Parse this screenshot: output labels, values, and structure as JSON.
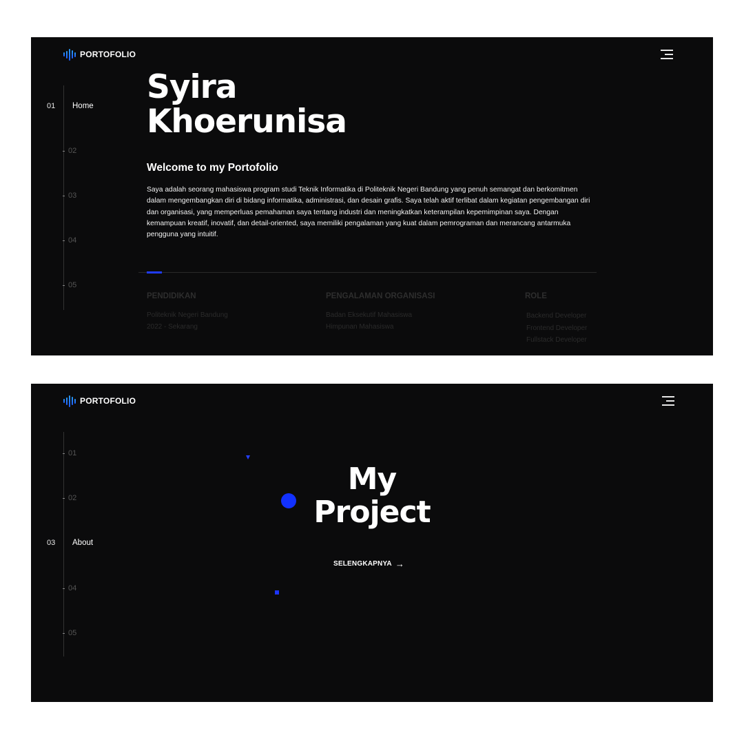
{
  "brand": {
    "logo_text": "PORTOFOLIO",
    "accent_color": "#1f3bff"
  },
  "screen1": {
    "sidebar": [
      {
        "num": "01",
        "label": "Home",
        "active": true
      },
      {
        "num": "02"
      },
      {
        "num": "03"
      },
      {
        "num": "04"
      },
      {
        "num": "05"
      }
    ],
    "hero": {
      "name_line1": "Syira",
      "name_line2": "Khoerunisa"
    },
    "welcome_title": "Welcome to my Portofolio",
    "intro": "Saya adalah seorang mahasiswa program studi Teknik Informatika di Politeknik Negeri Bandung yang penuh semangat dan berkomitmen dalam mengembangkan diri di bidang informatika, administrasi, dan desain grafis. Saya telah aktif terlibat dalam kegiatan pengembangan diri dan organisasi, yang memperluas pemahaman saya tentang industri dan meningkatkan keterampilan kepemimpinan saya. Dengan kemampuan kreatif, inovatif, dan detail-oriented, saya memiliki pengalaman yang kuat dalam pemrograman dan merancang antarmuka pengguna yang intuitif.",
    "info": {
      "pendidikan": {
        "title": "PENDIDIKAN",
        "lines": [
          "Politeknik Negeri Bandung",
          "2022 - Sekarang"
        ]
      },
      "organisasi": {
        "title": "PENGALAMAN ORGANISASI",
        "lines": [
          "Badan Eksekutif Mahasiswa",
          "Himpunan Mahasiswa"
        ]
      },
      "role": {
        "title": "ROLE",
        "lines": [
          "Backend Developer",
          "Frontend Developer",
          "Fullstack Developer"
        ]
      }
    }
  },
  "screen2": {
    "sidebar": [
      {
        "num": "01"
      },
      {
        "num": "02"
      },
      {
        "num": "03",
        "label": "About",
        "active": true
      },
      {
        "num": "04"
      },
      {
        "num": "05"
      }
    ],
    "title_line1": "My",
    "title_line2": "Project",
    "cta_label": "SELENGKAPNYA",
    "cta_icon": "arrow-right-icon"
  }
}
